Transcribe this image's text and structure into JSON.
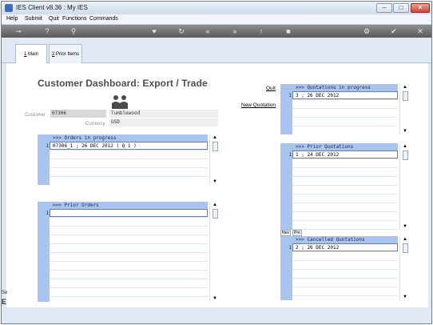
{
  "window": {
    "title": "IES Client v8.36 : My IES"
  },
  "menu": [
    "Help",
    "Submit",
    "Quit",
    "Functions",
    "Commands"
  ],
  "toolbar": {
    "icons": [
      "key-icon",
      "help-icon",
      "search-icon",
      "heart-icon",
      "refresh-icon",
      "rewind-icon",
      "forward-icon",
      "up-icon",
      "stop-icon",
      "gear-icon",
      "check-icon",
      "close-icon"
    ],
    "glyphs": [
      "⊸",
      "?",
      "⚲",
      "♥",
      "↻",
      "«",
      "»",
      "↑",
      "■",
      "⚙",
      "✔",
      "✕"
    ]
  },
  "tabs": [
    {
      "key": "1",
      "label": " Main"
    },
    {
      "key": "2",
      "label": " Prior Items"
    }
  ],
  "page_title": "Customer Dashboard: Export / Trade",
  "customer": {
    "label": "Customer",
    "code": "07306",
    "name": "Tumblewood",
    "currency_label": "Currency",
    "currency": "USD"
  },
  "links": {
    "quit": "Quit",
    "new_quotation": "New Quotation"
  },
  "grids": {
    "orders_in_progress": {
      "header": ">>> Orders in progress",
      "rows": [
        "07306_1 ; 26 DEC 2012 ( Q 1 )"
      ]
    },
    "prior_orders": {
      "header": ">>> Prior Orders",
      "rows": [
        ""
      ]
    },
    "quotations_in_progress": {
      "header": ">>> Quotations in progress",
      "rows": [
        "3 ; 26 DEC 2012"
      ]
    },
    "prior_quotations": {
      "header": ">>> Prior Quotations",
      "rows": [
        "1 ; 24 DEC 2012"
      ]
    },
    "cancelled_quotations": {
      "header": ">>> Cancelled Quotations",
      "rows": [
        "2 ; 26 DEC 2012"
      ]
    }
  },
  "row_number": "1",
  "mini_buttons": {
    "next": "Nex",
    "prev": "Pre"
  },
  "left_edge": {
    "line1": "Se",
    "line2": "E"
  },
  "scroll": {
    "up": "▲",
    "down": "▼"
  }
}
